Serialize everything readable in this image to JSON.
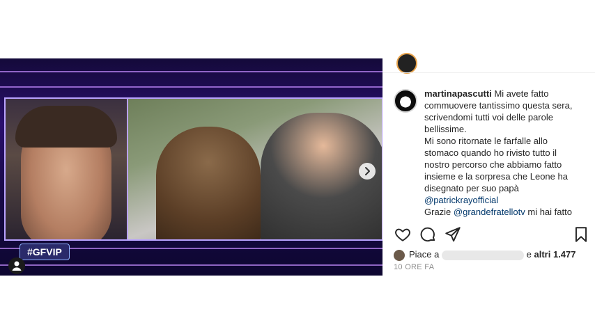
{
  "media": {
    "badge": "#GFVIP"
  },
  "caption": {
    "username": "martinapascutti",
    "line1": "Mi avete fatto",
    "line2": "commuovere tantissimo questa sera,",
    "line3": "scrivendomi tutti voi delle parole",
    "line4": "bellissime.",
    "line5": "Mi sono ritornate le farfalle allo",
    "line6": "stomaco quando ho rivisto tutto il",
    "line7": "nostro percorso che abbiamo fatto",
    "line8": "insieme e la sorpresa che Leone ha",
    "line9": "disegnato per suo papà",
    "mention1": "@patrickrayofficial",
    "line10_prefix": "Grazie",
    "mention2": "@grandefratellotv",
    "line10_suffix": "mi hai fatto"
  },
  "likes": {
    "prefix": "Piace a",
    "suffix": "e",
    "others": "altri 1.477"
  },
  "time": "10 ORE FA",
  "icons": [
    "heart-icon",
    "comment-icon",
    "share-icon",
    "bookmark-icon",
    "next-icon",
    "user-tag-icon"
  ]
}
